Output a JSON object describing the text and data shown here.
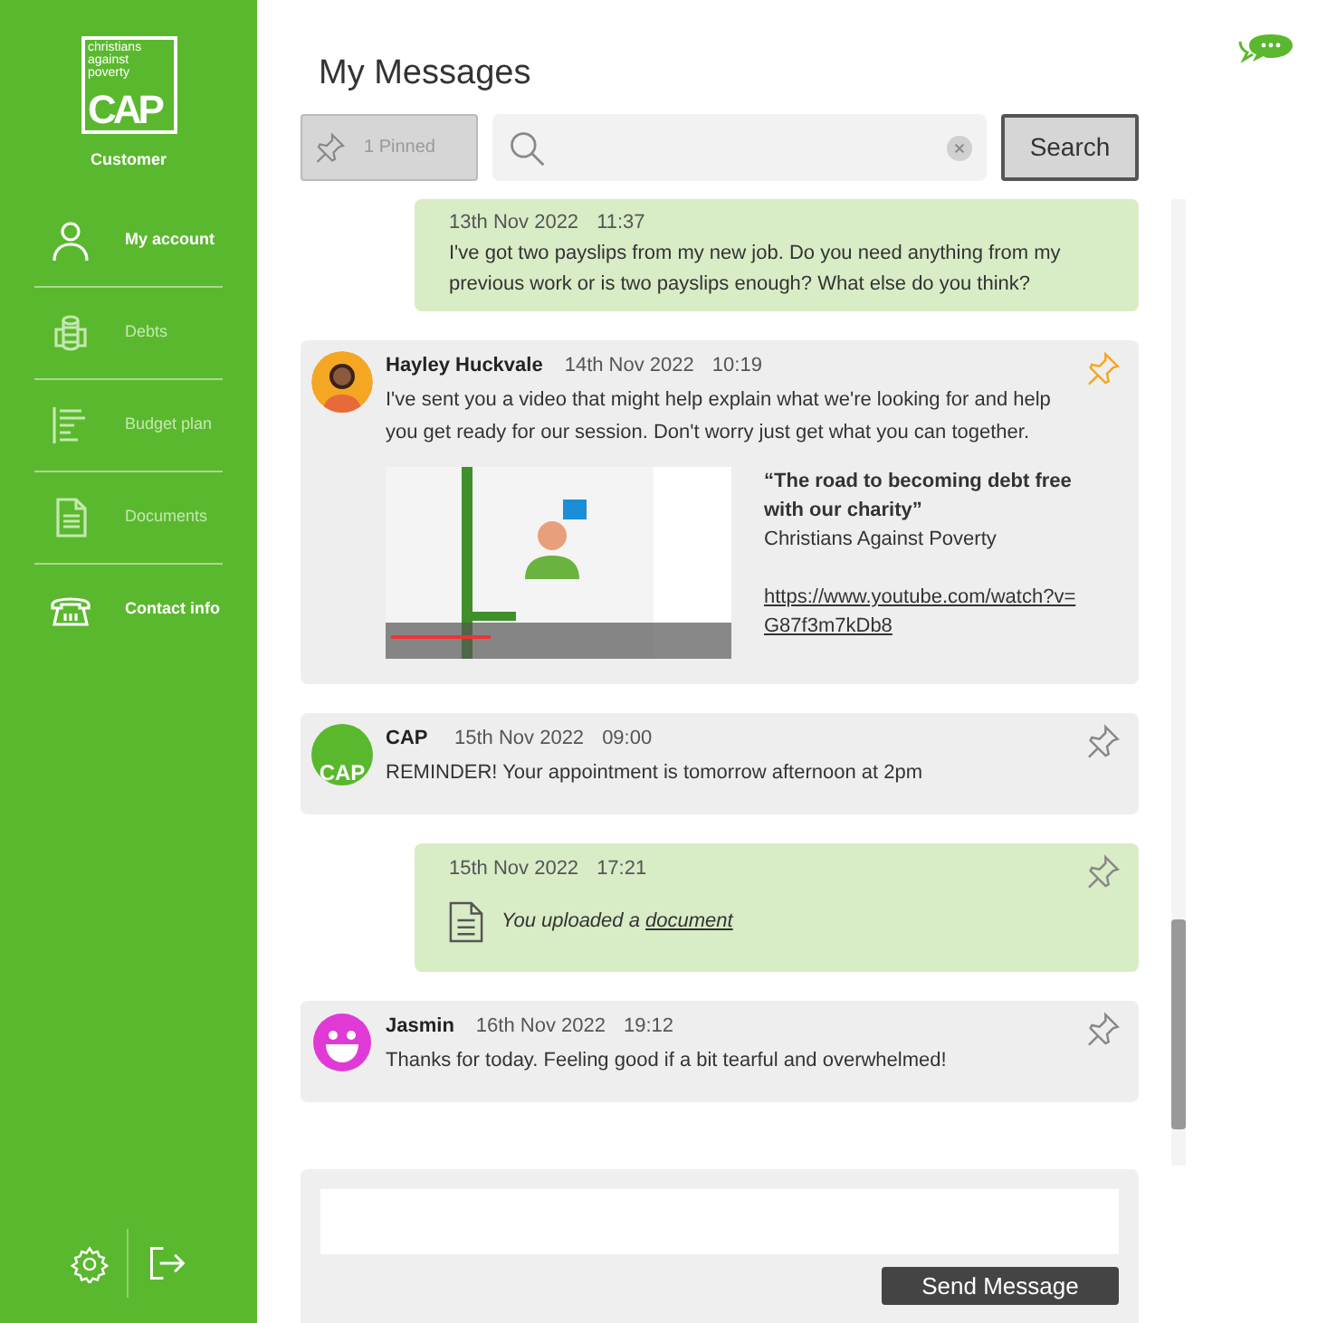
{
  "sidebar": {
    "logo": {
      "lines": [
        "christians",
        "against",
        "poverty"
      ],
      "wordmark": "CAP"
    },
    "role": "Customer",
    "items": [
      {
        "label": "My account",
        "disabled": false
      },
      {
        "label": "Debts",
        "disabled": true
      },
      {
        "label": "Budget plan",
        "disabled": true
      },
      {
        "label": "Documents",
        "disabled": true
      },
      {
        "label": "Contact info",
        "disabled": false
      }
    ]
  },
  "header": {
    "title": "My Messages",
    "pinned_button": "1 Pinned",
    "search_button": "Search"
  },
  "messages": [
    {
      "kind": "sent",
      "date": "13th Nov 2022",
      "time": "11:37",
      "text": "I've got two payslips from my new job. Do you need anything from my previous work or is two payslips enough? What else do you think?",
      "pinned": false
    },
    {
      "kind": "received",
      "sender": "Hayley Huckvale",
      "date": "14th Nov 2022",
      "time": "10:19",
      "text": "I've sent you a video that might help explain what we're looking for and help you get ready for our session. Don't worry just get what you can together.",
      "pinned": true,
      "video": {
        "title": "“The road to becoming debt free with our charity”",
        "channel": "Christians Against Poverty",
        "url": "https://www.youtube.com/watch?v=G87f3m7kDb8"
      }
    },
    {
      "kind": "received",
      "avatar": {
        "kind": "logo",
        "text": "CAP"
      },
      "sender": "CAP",
      "date": "15th Nov 2022",
      "time": "09:00",
      "text": "REMINDER! Your appointment is tomorrow afternoon at 2pm",
      "pinned": false
    },
    {
      "kind": "upload",
      "date": "15th Nov 2022",
      "time": "17:21",
      "text": "You uploaded a ",
      "link": "document",
      "pinned": false
    },
    {
      "kind": "received",
      "avatar": {
        "kind": "smiley"
      },
      "sender": "Jasmin",
      "date": "16th Nov 2022",
      "time": "19:12",
      "text": "Thanks for today. Feeling good if a bit tearful and overwhelmed!",
      "pinned": false
    }
  ],
  "composer": {
    "send_button": "Send Message"
  }
}
